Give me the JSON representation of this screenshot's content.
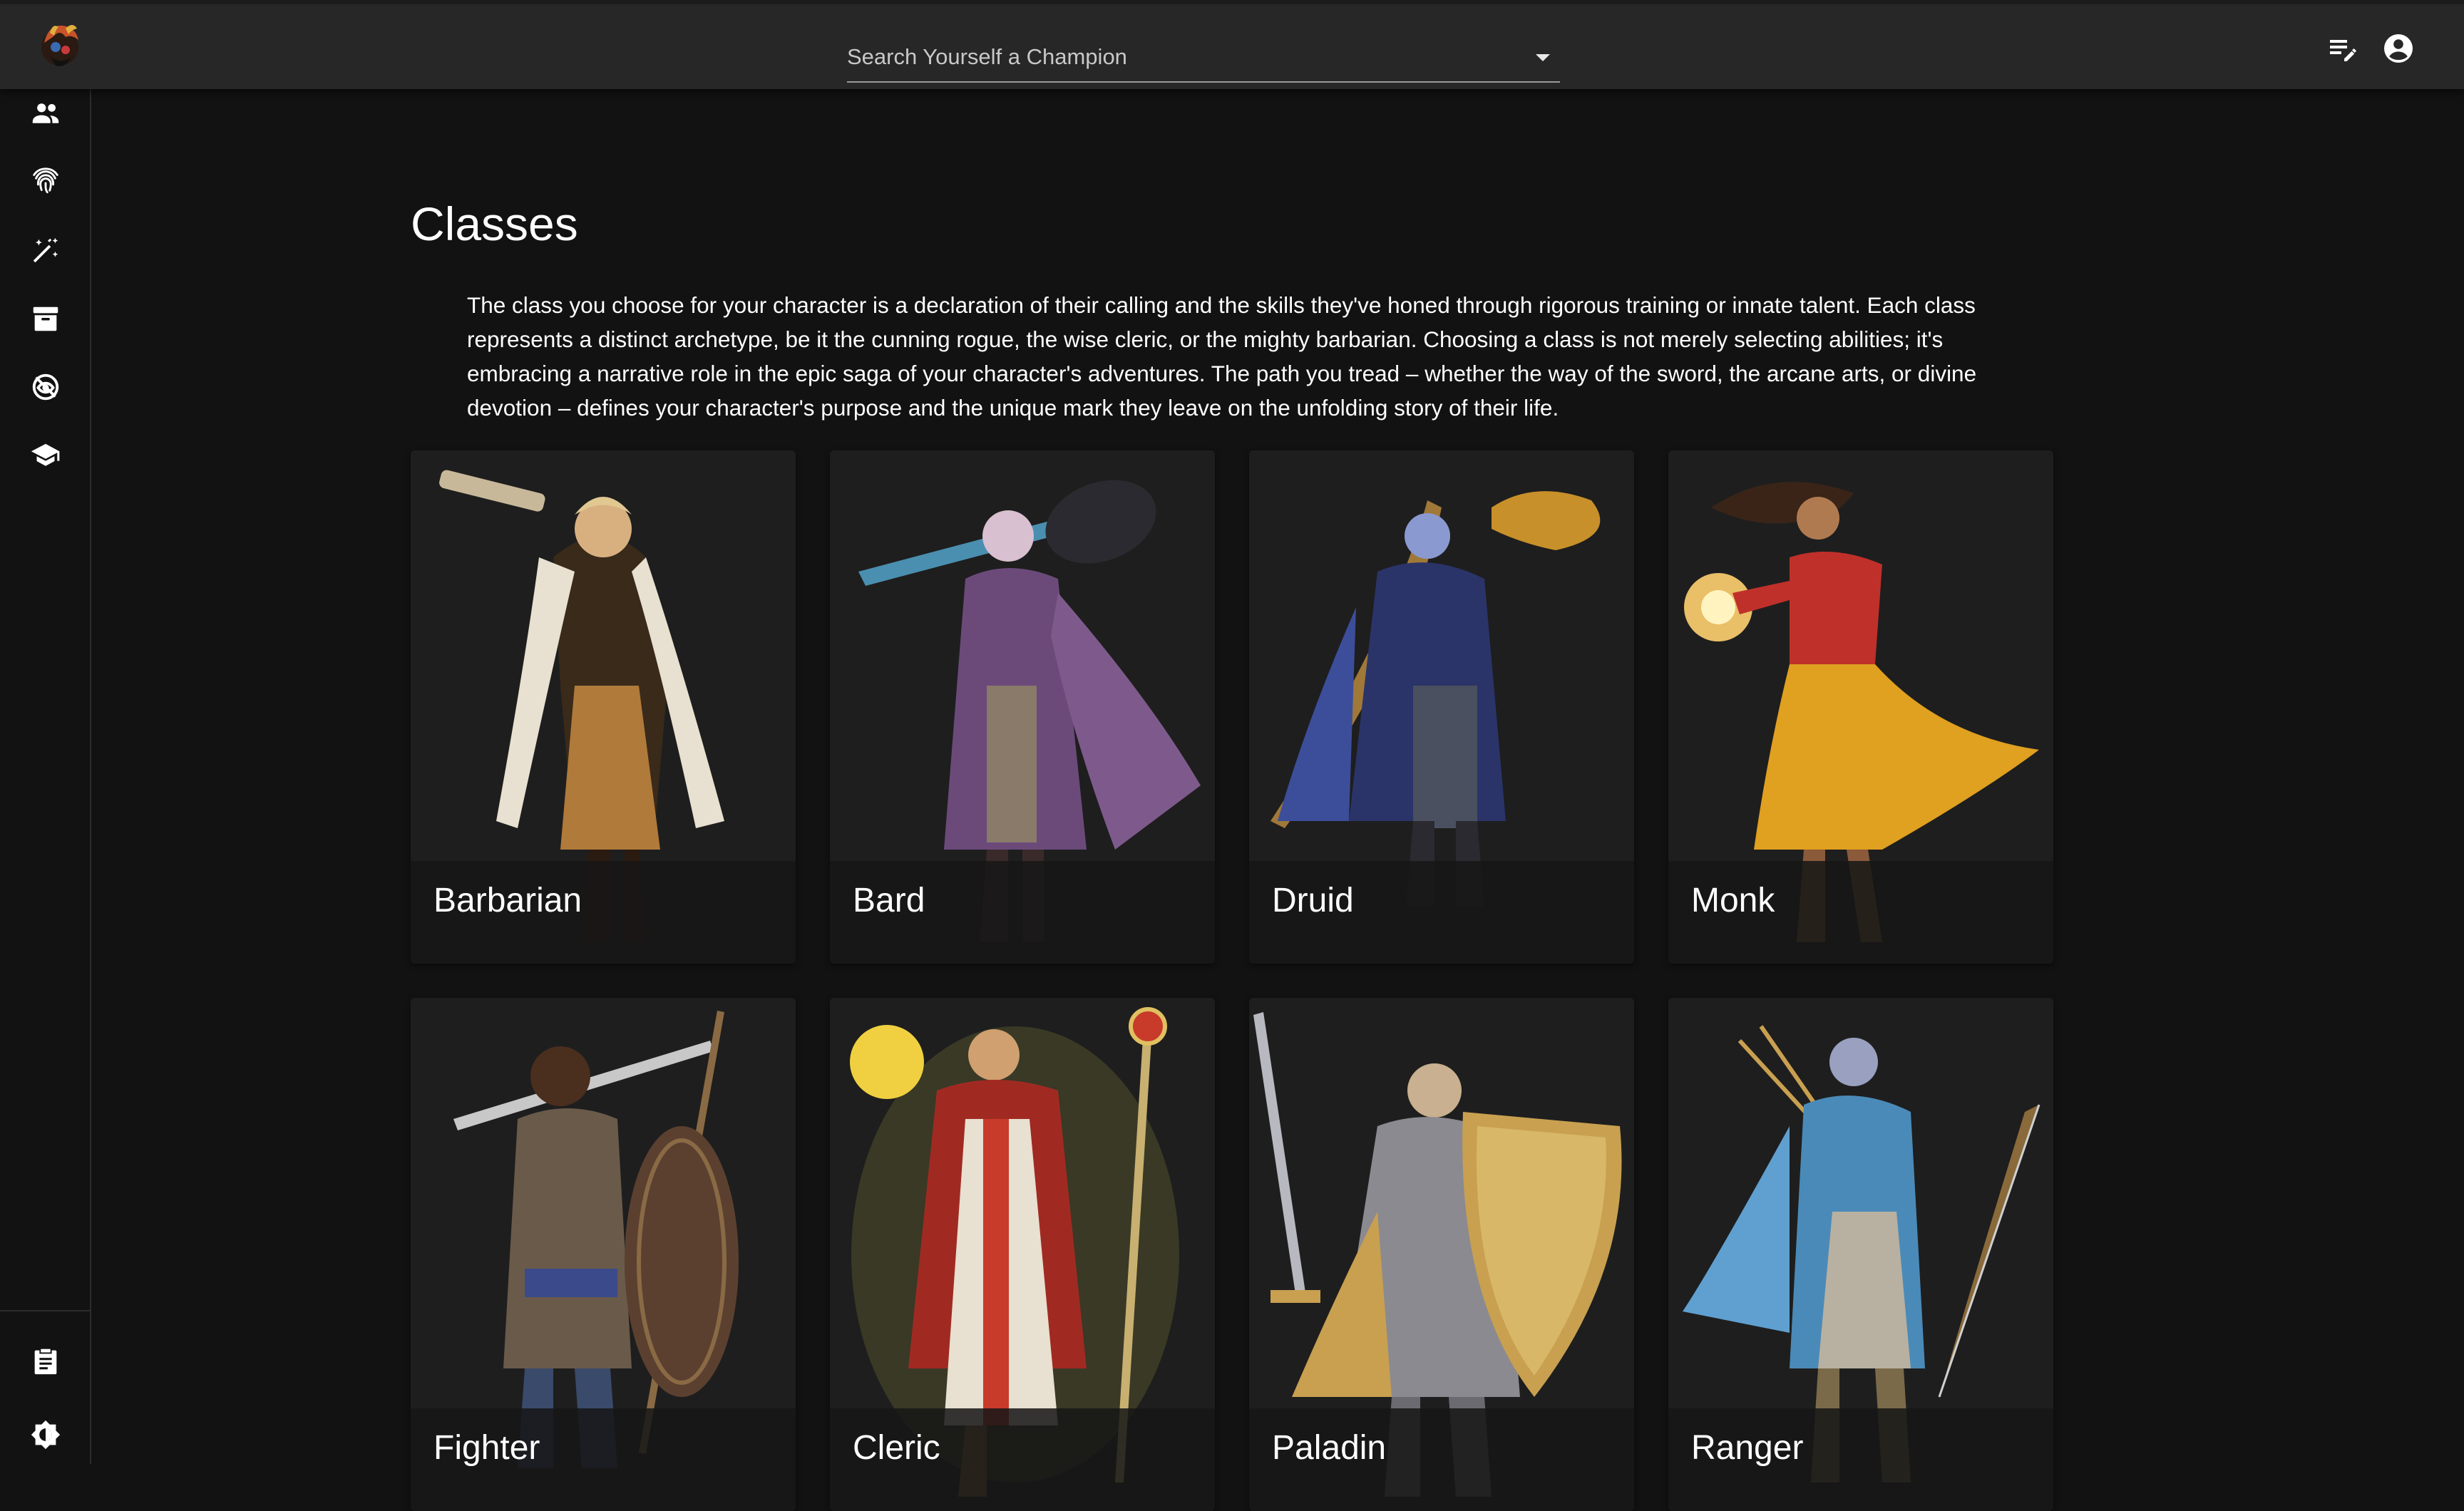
{
  "search": {
    "placeholder": "Search Yourself a Champion"
  },
  "icons": {
    "logo": "dragon-logo-icon",
    "topbar": [
      "playlist-edit-icon",
      "account-circle-icon"
    ],
    "sidenav": [
      "people-icon",
      "fingerprint-icon",
      "magic-wand-icon",
      "archive-icon",
      "eye-off-icon",
      "school-icon"
    ],
    "sidenav_bottom": [
      "clipboard-icon",
      "brightness-icon"
    ]
  },
  "page": {
    "title": "Classes",
    "intro": "The class you choose for your character is a declaration of their calling and the skills they've honed through rigorous training or innate talent. Each class represents a distinct archetype, be it the cunning rogue, the wise cleric, or the mighty barbarian. Choosing a class is not merely selecting abilities; it's embracing a narrative role in the epic saga of your character's adventures. The path you tread – whether the way of the sword, the arcane arts, or divine devotion – defines your character's purpose and the unique mark they leave on the unfolding story of their life."
  },
  "classes": [
    {
      "name": "Barbarian",
      "accent": "#c8963c",
      "cloak": "#3a2a1a"
    },
    {
      "name": "Bard",
      "accent": "#7e5a8c",
      "cloak": "#5a3e6b"
    },
    {
      "name": "Druid",
      "accent": "#3c4e9a",
      "cloak": "#2a3468"
    },
    {
      "name": "Monk",
      "accent": "#e0a020",
      "cloak": "#c0302a"
    },
    {
      "name": "Fighter",
      "accent": "#8a6a44",
      "cloak": "#5b4030"
    },
    {
      "name": "Cleric",
      "accent": "#d8c470",
      "cloak": "#a02a22"
    },
    {
      "name": "Paladin",
      "accent": "#c8a050",
      "cloak": "#8a7048"
    },
    {
      "name": "Ranger",
      "accent": "#5fa0d0",
      "cloak": "#2e6a9a"
    }
  ],
  "colors": {
    "appbar": "#272727",
    "background": "#121212",
    "card": "#1e1e1e"
  }
}
